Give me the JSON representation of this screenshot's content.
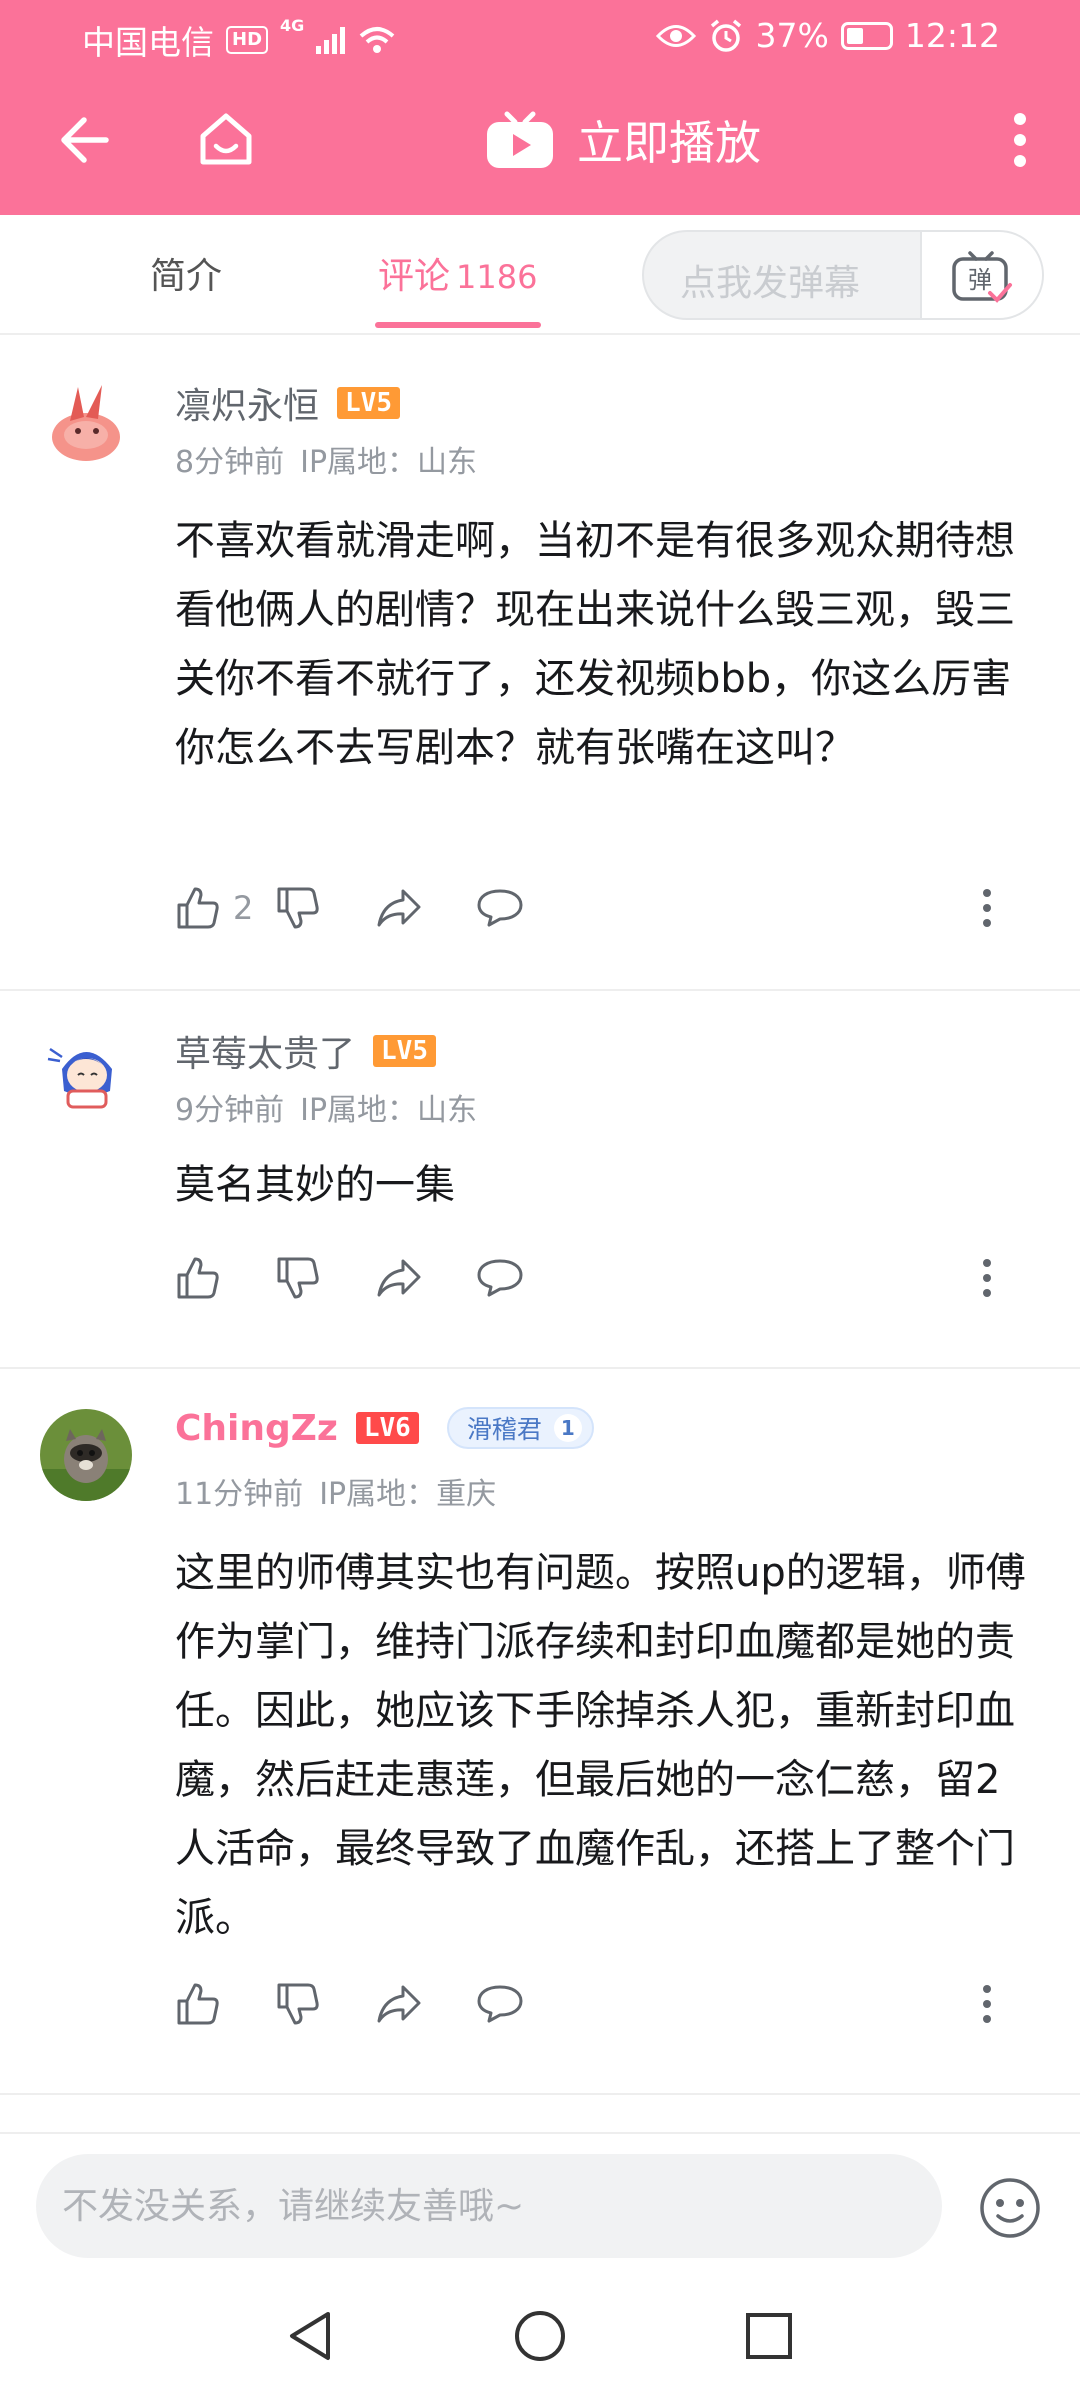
{
  "status_bar": {
    "carrier": "中国电信",
    "hd": "HD",
    "network": "4G",
    "battery": "37%",
    "time": "12:12"
  },
  "header": {
    "play_now_label": "立即播放",
    "icons": [
      "back-arrow-icon",
      "home-icon",
      "tv-play-icon",
      "more-vertical-icon"
    ]
  },
  "tabs": {
    "intro_label": "简介",
    "comments_label": "评论",
    "comments_count": "1186",
    "danmaku_placeholder": "点我发弹幕",
    "danmaku_icon": "弹"
  },
  "comments": [
    {
      "username": "凛炽永恒",
      "level": "LV5",
      "time": "8分钟前",
      "ip": "IP属地：山东",
      "text": "不喜欢看就滑走啊，当初不是有很多观众期待想看他俩人的剧情？现在出来说什么毁三观，毁三关你不看不就行了，还发视频bbb，你这么厉害你怎么不去写剧本？就有张嘴在这叫？",
      "likes": "2"
    },
    {
      "username": "草莓太贵了",
      "level": "LV5",
      "time": "9分钟前",
      "ip": "IP属地：山东",
      "text": "莫名其妙的一集",
      "likes": ""
    },
    {
      "username": "ChingZz",
      "level": "LV6",
      "medal_name": "滑稽君",
      "medal_level": "1",
      "time": "11分钟前",
      "ip": "IP属地：重庆",
      "text": "这里的师傅其实也有问题。按照up的逻辑，师傅作为掌门，维持门派存续和封印血魔都是她的责任。因此，她应该下手除掉杀人犯，重新封印血魔，然后赶走惠莲，但最后她的一念仁慈，留2人活命，最终导致了血魔作乱，还搭上了整个门派。",
      "likes": ""
    }
  ],
  "bottom": {
    "reply_placeholder": "不发没关系，请继续友善哦~"
  },
  "colors": {
    "brand_pink": "#fb7299",
    "lv5": "#ff9a35",
    "lv6": "#ff4a4a"
  }
}
